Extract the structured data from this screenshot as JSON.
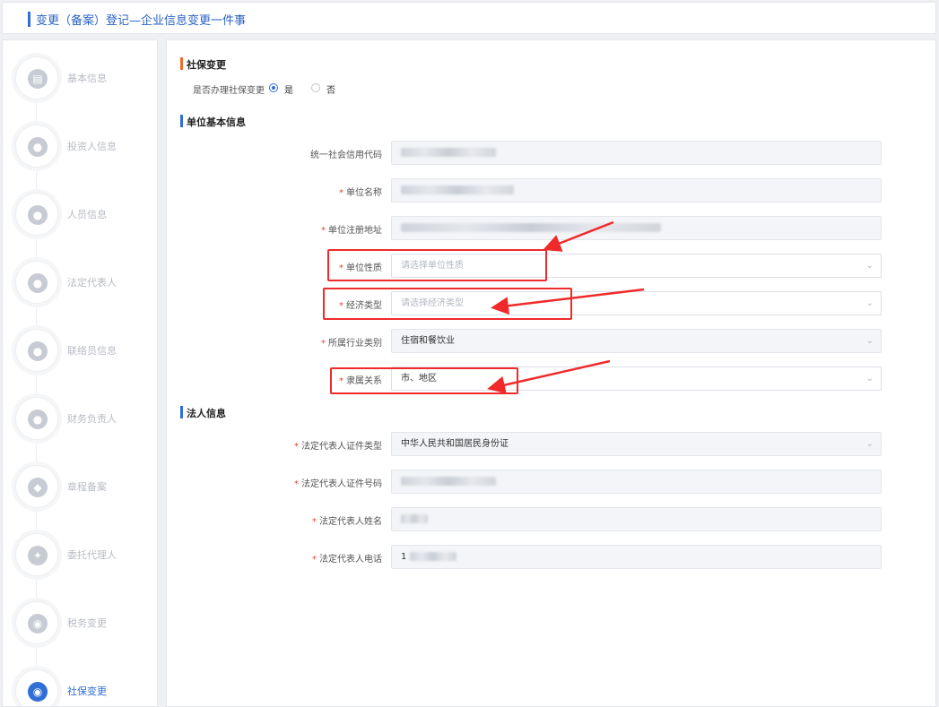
{
  "header": {
    "title": "变更（备案）登记—企业信息变更一件事"
  },
  "sidebar": {
    "steps": [
      {
        "label": "基本信息",
        "icon": "document-icon",
        "glyph": "▤"
      },
      {
        "label": "投资人信息",
        "icon": "investor-icon",
        "glyph": "●"
      },
      {
        "label": "人员信息",
        "icon": "people-icon",
        "glyph": "●"
      },
      {
        "label": "法定代表人",
        "icon": "person-icon",
        "glyph": "●"
      },
      {
        "label": "联络员信息",
        "icon": "contact-person-icon",
        "glyph": "●"
      },
      {
        "label": "财务负责人",
        "icon": "finance-person-icon",
        "glyph": "●"
      },
      {
        "label": "章程备案",
        "icon": "shield-icon",
        "glyph": "◆"
      },
      {
        "label": "委托代理人",
        "icon": "handshake-icon",
        "glyph": "✦"
      },
      {
        "label": "税务变更",
        "icon": "eye-icon",
        "glyph": "◉"
      },
      {
        "label": "社保变更",
        "icon": "eye-icon",
        "glyph": "◉",
        "active": true
      }
    ]
  },
  "social_security": {
    "section_title": "社保变更",
    "question": "是否办理社保变更",
    "option_yes": "是",
    "option_no": "否",
    "selected": "是"
  },
  "unit_info": {
    "section_title": "单位基本信息",
    "credit_code_label": "统一社会信用代码",
    "unit_name_label": "单位名称",
    "unit_address_label": "单位注册地址",
    "unit_nature_label": "单位性质",
    "unit_nature_placeholder": "请选择单位性质",
    "economic_type_label": "经济类型",
    "economic_type_placeholder": "请选择经济类型",
    "industry_label": "所属行业类别",
    "industry_value": "住宿和餐饮业",
    "affiliation_label": "隶属关系",
    "affiliation_value": "市、地区"
  },
  "legal_info": {
    "section_title": "法人信息",
    "id_type_label": "法定代表人证件类型",
    "id_type_value": "中华人民共和国居民身份证",
    "id_number_label": "法定代表人证件号码",
    "name_label": "法定代表人姓名",
    "phone_label": "法定代表人电话",
    "phone_prefix": "1"
  },
  "required_mark": "*",
  "colors": {
    "accent": "#2f6fd6",
    "required": "#e0462f",
    "annotation": "#f02a2a",
    "section_orange": "#ef6a2c"
  }
}
